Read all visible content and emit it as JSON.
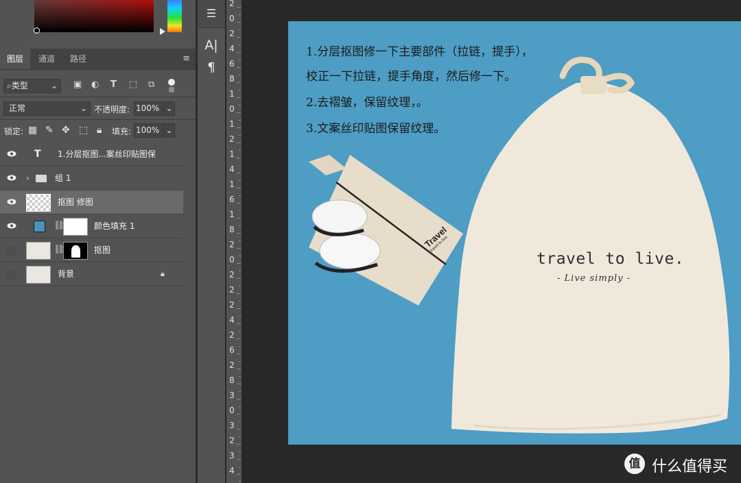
{
  "tabs": {
    "layers": "图层",
    "channels": "通道",
    "paths": "路径"
  },
  "filter": {
    "kind_label": "类型"
  },
  "blend": {
    "mode": "正常",
    "opacity_label": "不透明度:",
    "opacity_value": "100%"
  },
  "lock": {
    "label": "锁定:",
    "fill_label": "填充:",
    "fill_value": "100%"
  },
  "layers": [
    {
      "name": "1.分层抠图...案丝印贴图保",
      "kind": "T"
    },
    {
      "name": "组 1"
    },
    {
      "name": "抠图 修图"
    },
    {
      "name": "颜色填充 1"
    },
    {
      "name": "抠图"
    },
    {
      "name": "背景"
    }
  ],
  "ruler_labels": [
    "2",
    "0",
    "2",
    "4",
    "6",
    "8",
    "1",
    "0",
    "1",
    "2",
    "1",
    "4",
    "1",
    "6",
    "1",
    "8",
    "2",
    "0",
    "2",
    "2",
    "2",
    "4",
    "2",
    "6",
    "2",
    "8",
    "3",
    "0",
    "3",
    "2",
    "3",
    "4"
  ],
  "canvas": {
    "notes": [
      "1.分层抠图修一下主要部件（拉链，提手），",
      "校正一下拉链，提手角度，然后修一下。",
      "2.去褶皱，保留纹理，。",
      "3.文案丝印贴图保留纹理。"
    ],
    "brand_main": "travel to live.",
    "brand_sub": "- Live simply -",
    "small_bag_brand": "Travel",
    "small_bag_sub": "travel to live"
  },
  "watermark": {
    "logo": "值",
    "text": "什么值得买"
  },
  "colors": {
    "artboard_bg": "#4e9dc4",
    "panel_bg": "#535353",
    "workspace_bg": "#282828"
  }
}
